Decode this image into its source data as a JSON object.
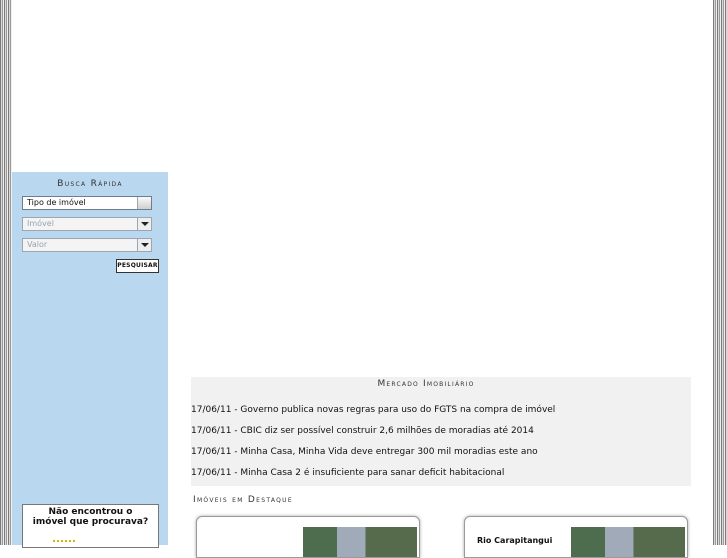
{
  "sidebar": {
    "title": "Busca Rápida",
    "selects": [
      {
        "value": "Tipo de imóvel"
      },
      {
        "value": "Imóvel"
      },
      {
        "value": "Valor"
      }
    ],
    "search_label": "PESQUISAR",
    "not_found_line1": "Não encontrou o",
    "not_found_line2": "imóvel que procurava?"
  },
  "news": {
    "title": "Mercado Imobiliário",
    "items": [
      "17/06/11 - Governo publica novas regras para uso do FGTS na compra de imóvel",
      "17/06/11 - CBIC diz ser possível construir 2,6 milhões de moradias até 2014",
      "17/06/11 - Minha Casa, Minha Vida deve entregar 300 mil moradias este ano",
      "17/06/11 - Minha Casa 2 é insuficiente para sanar deficit habitacional"
    ]
  },
  "featured": {
    "title": "Imóveis em Destaque",
    "cards": [
      {
        "label": ""
      },
      {
        "label": "Rio Carapitangui"
      }
    ]
  }
}
